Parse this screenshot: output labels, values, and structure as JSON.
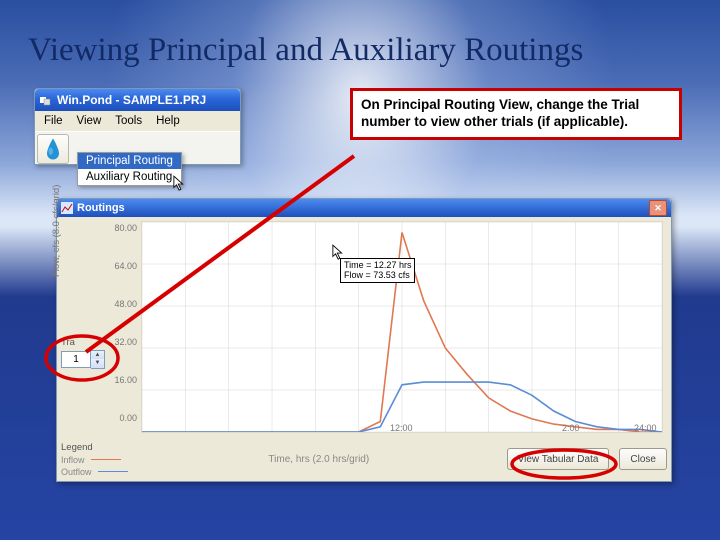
{
  "slide_title": "Viewing Principal and Auxiliary Routings",
  "callout_text": "On Principal Routing View, change the Trial number to view other trials (if applicable).",
  "small_window": {
    "title": "Win.Pond - SAMPLE1.PRJ",
    "menus": [
      "File",
      "View",
      "Tools",
      "Help"
    ],
    "submenu": [
      "Principal Routing",
      "Auxiliary Routing"
    ]
  },
  "big_window": {
    "title": "Routings",
    "trial_label": "Tra",
    "trial_value": "1",
    "y_ticks": [
      "80.00",
      "64.00",
      "48.00",
      "32.00",
      "16.00",
      "0.00"
    ],
    "x_ticks": [
      "",
      "",
      "12:00",
      "",
      "2:00",
      "",
      "24:00"
    ],
    "x_axis_title": "Time, hrs  (2.0 hrs/grid)",
    "y_axis_title": "Flow, cfs  (8.0 cfs/grid)",
    "hover": {
      "l1": "Time = 12.27 hrs",
      "l2": "Flow = 73.53 cfs"
    },
    "legend_title": "Legend",
    "legend": [
      {
        "name": "Inflow",
        "color": "#e07850"
      },
      {
        "name": "Outflow",
        "color": "#5a8cd8"
      }
    ],
    "buttons": {
      "tabular": "View Tabular Data",
      "close": "Close"
    }
  },
  "chart_data": {
    "type": "line",
    "xlabel": "Time, hrs  (2.0 hrs/grid)",
    "ylabel": "Flow, cfs  (8.0 cfs/grid)",
    "ylim": [
      0,
      80
    ],
    "xlim": [
      0,
      24
    ],
    "series": [
      {
        "name": "Inflow",
        "values": [
          0,
          0,
          0,
          0,
          0,
          0,
          0,
          0,
          0,
          0,
          0,
          4,
          76,
          50,
          32,
          22,
          13,
          8,
          5,
          3,
          2,
          1,
          1,
          0,
          0
        ]
      },
      {
        "name": "Outflow",
        "values": [
          0,
          0,
          0,
          0,
          0,
          0,
          0,
          0,
          0,
          0,
          0,
          2,
          18,
          19,
          19,
          19,
          19,
          18,
          14,
          8,
          4,
          2,
          1,
          1,
          0
        ]
      }
    ],
    "x": [
      0,
      1,
      2,
      3,
      4,
      5,
      6,
      7,
      8,
      9,
      10,
      11,
      12,
      13,
      14,
      15,
      16,
      17,
      18,
      19,
      20,
      21,
      22,
      23,
      24
    ],
    "annotation": {
      "x": 12.27,
      "y": 73.53,
      "text": "Time = 12.27 hrs\nFlow = 73.53 cfs"
    }
  }
}
